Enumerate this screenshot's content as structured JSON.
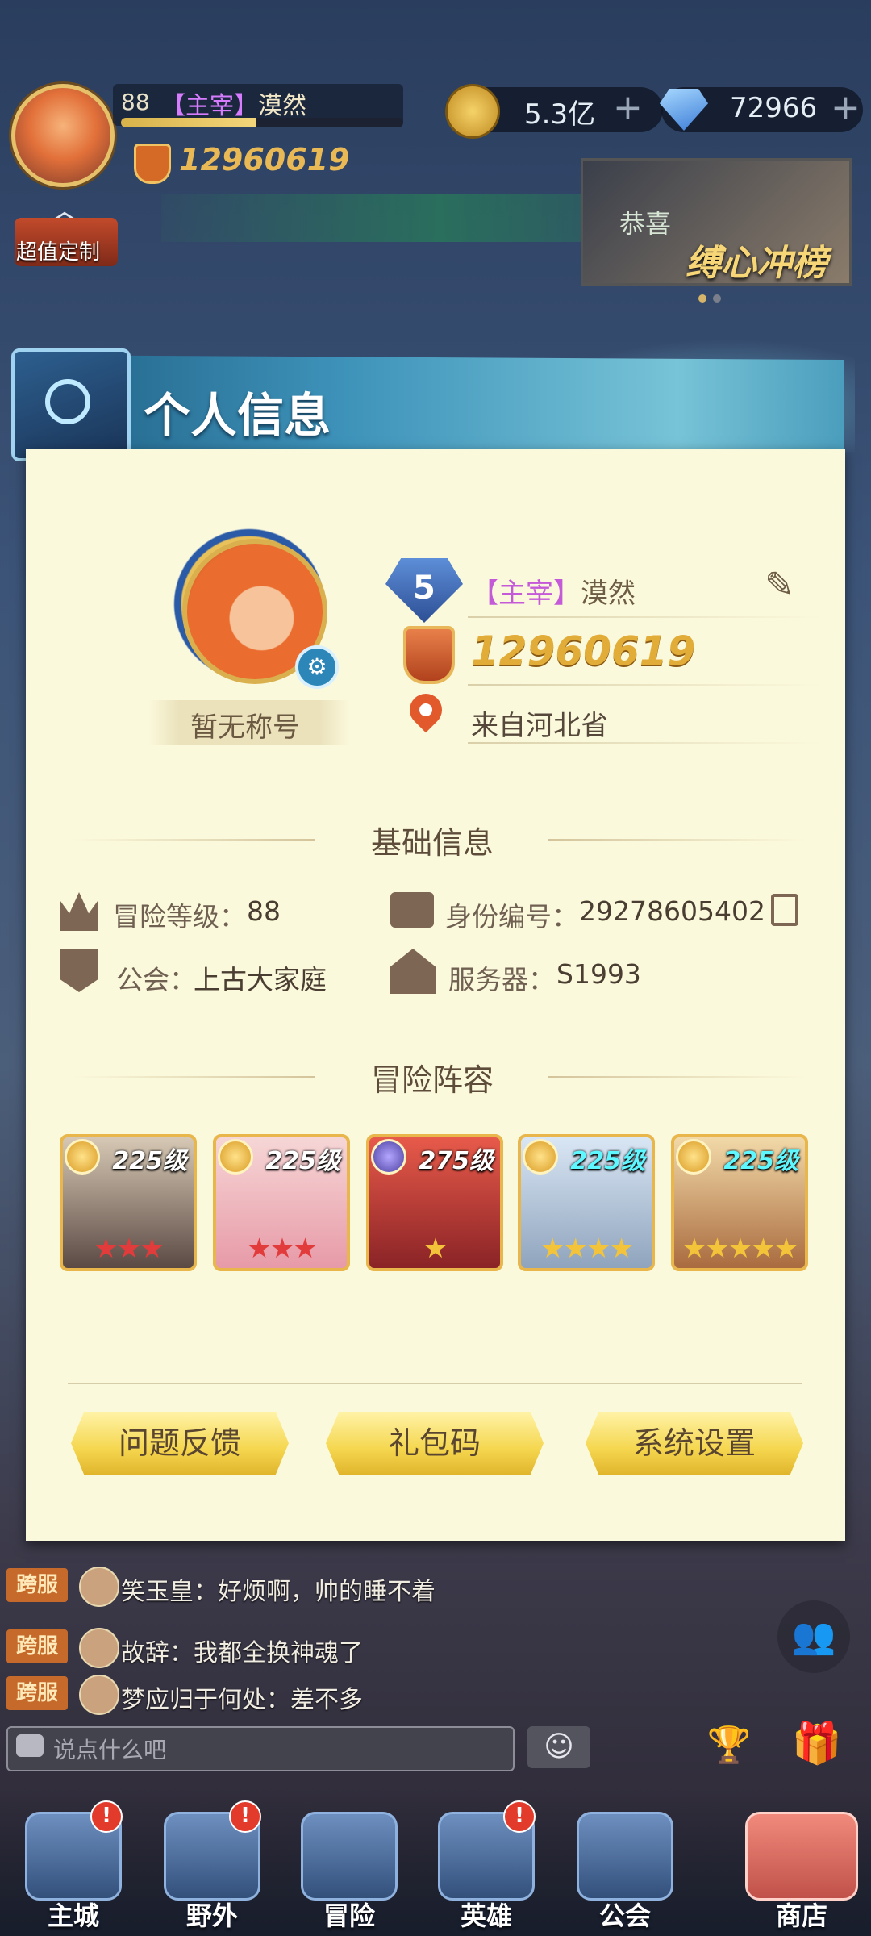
{
  "hud": {
    "level": "88",
    "name_tag": "【主宰】",
    "name": "漠然",
    "exp_progress": 0.48,
    "power": "12960619",
    "gold": "5.3亿",
    "gems": "72966",
    "plus": "+"
  },
  "side": {
    "custom_label": "超值定制"
  },
  "banner": {
    "congrats": "恭喜",
    "event_title": "缚心冲榜"
  },
  "panel": {
    "title": "个人信息",
    "title_badge": "暂无称号",
    "vip_level": "5",
    "name_tag": "【主宰】",
    "name": "漠然",
    "power": "12960619",
    "location": "来自河北省",
    "basic_section": "基础信息",
    "adventure_level_label": "冒险等级：",
    "adventure_level": "88",
    "id_label": "身份编号：",
    "id_value": "29278605402",
    "guild_label": "公会：",
    "guild_value": "上古大家庭",
    "server_label": "服务器：",
    "server_value": "S1993",
    "lineup_section": "冒险阵容",
    "heroes": [
      {
        "level": "225级",
        "stars": "★★★",
        "star_color": "#e23b3b",
        "rank": "gold",
        "level_color": "white"
      },
      {
        "level": "225级",
        "stars": "★★★",
        "star_color": "#e23b3b",
        "rank": "gold",
        "level_color": "white"
      },
      {
        "level": "275级",
        "stars": "★",
        "star_color": "#f3c33a",
        "rank": "purple",
        "level_color": "white"
      },
      {
        "level": "225级",
        "stars": "★★★★",
        "star_color": "#f3c33a",
        "rank": "gold",
        "level_color": "cyan"
      },
      {
        "level": "225级",
        "stars": "★★★★★",
        "star_color": "#f3c33a",
        "rank": "gold",
        "level_color": "cyan"
      }
    ],
    "buttons": {
      "feedback": "问题反馈",
      "gift_code": "礼包码",
      "settings": "系统设置"
    }
  },
  "chat": {
    "messages": [
      {
        "tag": "跨服",
        "text": "笑玉皇：好烦啊，帅的睡不着"
      },
      {
        "tag": "跨服",
        "text": "故辞：我都全换神魂了"
      },
      {
        "tag": "跨服",
        "text": "梦应归于何处：差不多"
      }
    ],
    "placeholder": "说点什么吧"
  },
  "nav": {
    "items": [
      {
        "label": "主城",
        "badge": "!"
      },
      {
        "label": "野外",
        "badge": "!"
      },
      {
        "label": "冒险",
        "badge": ""
      },
      {
        "label": "英雄",
        "badge": "!"
      },
      {
        "label": "公会",
        "badge": ""
      },
      {
        "label": "商店",
        "badge": ""
      }
    ]
  }
}
